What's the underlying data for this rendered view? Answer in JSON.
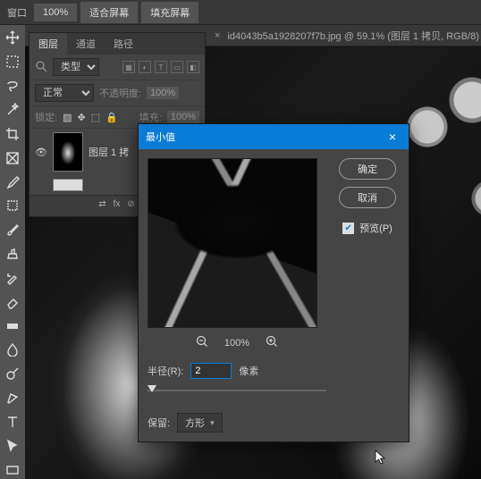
{
  "topbar": {
    "partial": "窗口",
    "zoom": "100%",
    "fit": "适合屏幕",
    "fill": "填充屏幕"
  },
  "doc": {
    "close": "×",
    "title": "id4043b5a1928207f7b.jpg @ 59.1% (图层 1 拷贝, RGB/8)"
  },
  "layers_panel": {
    "tabs": [
      "图层",
      "通道",
      "路径"
    ],
    "active_tab": 0,
    "kind_placeholder": "类型",
    "blend": "正常",
    "opacity_label": "不透明度:",
    "opacity": "100%",
    "lock_label": "锁定:",
    "fill_label": "填充:",
    "fill_value": "100%",
    "layer1": "图层 1 拷",
    "footer": [
      "fx",
      "⊘",
      "□",
      "○",
      "▣",
      "＋",
      "🗑"
    ]
  },
  "dialog": {
    "title": "最小值",
    "ok": "确定",
    "cancel": "取消",
    "preview_label": "预览(P)",
    "preview_checked": true,
    "zoom": "100%",
    "radius_label": "半径(R):",
    "radius": "2",
    "radius_unit": "像素",
    "keep_label": "保留:",
    "keep_value": "方形"
  }
}
